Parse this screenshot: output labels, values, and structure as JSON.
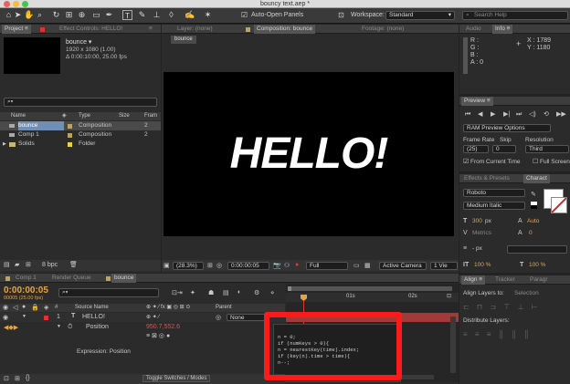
{
  "window": {
    "title": "bouncy text.aep *"
  },
  "toolbar": {
    "auto_open_label": "Auto-Open Panels",
    "workspace_label": "Workspace:",
    "workspace_value": "Standard",
    "search_placeholder": "Search Help"
  },
  "project": {
    "tabs": [
      "Project ≡",
      "Effect Controls: HELLO!"
    ],
    "preview_name": "bounce ▾",
    "preview_line1": "1920 x 1080 (1.00)",
    "preview_line2": "Δ 0:00:10:00, 25.00 fps",
    "search_value": "⌕▾",
    "columns": {
      "name": "Name",
      "type": "Type",
      "size": "Size",
      "frame": "Fram"
    },
    "items": [
      {
        "name": "bounce",
        "type": "Composition",
        "size": "2",
        "color": "#b8a36a"
      },
      {
        "name": "Comp 1",
        "type": "Composition",
        "size": "2",
        "color": "#b8a36a"
      },
      {
        "name": "Solids",
        "type": "Folder",
        "size": "",
        "color": "#e8d24a"
      }
    ],
    "bpc": "8 bpc"
  },
  "viewer": {
    "tabs": [
      "Layer: (none)",
      "Composition: bounce",
      "Footage: (none)"
    ],
    "breadcrumb": "bounce",
    "canvas_text": "HELLO!",
    "zoom": "(28.3%)",
    "timecode": "0:00:00:05",
    "resolution": "Full",
    "camera": "Active Camera",
    "views": "1 Vie"
  },
  "info": {
    "tabs": [
      "Audio",
      "Info ≡"
    ],
    "r": "R :",
    "g": "G :",
    "b": "B :",
    "a": "A : 0",
    "x": "X : 1789",
    "y": "Y : 1180"
  },
  "preview": {
    "tab": "Preview ≡",
    "ram_options": "RAM Preview Options",
    "frame_rate_label": "Frame Rate",
    "skip_label": "Skip",
    "resolution_label": "Resolution",
    "frame_rate": "(25)",
    "skip": "0",
    "resolution": "Third",
    "from_current": "From Current Time",
    "full_screen": "Full Screen"
  },
  "character": {
    "tabs": [
      "Effects & Presets",
      "Charact"
    ],
    "font": "Roboto",
    "style": "Medium Italic",
    "size": "300",
    "size_unit": "px",
    "leading": "Auto",
    "kerning": "Metrics",
    "tracking": "0",
    "indent": "- px",
    "vscale": "100 %",
    "hscale": "100 %"
  },
  "align": {
    "tabs": [
      "Align ≡",
      "Tracker",
      "Paragr"
    ],
    "layers_to": "Align Layers to:",
    "selection": "Selection",
    "distribute": "Distribute Layers:"
  },
  "timeline": {
    "tabs": [
      "Comp 1",
      "Render Queue",
      "bounce"
    ],
    "timecode": "0:00:00:05",
    "timecode_sub": "00005 (25.00 fps)",
    "search_value": "⌕▾",
    "col_source": "Source Name",
    "col_parent": "Parent",
    "layer_num": "1",
    "layer_name": "HELLO!",
    "layer_parent": "None",
    "property": "Position",
    "position_value": "950.7,552.6",
    "expression_label": "Expression: Position",
    "ruler": [
      "01s",
      "02s"
    ],
    "code": [
      "n = 0;",
      "if (numKeys > 0){",
      "n = nearestKey(time).index;",
      "if (key(n).time > time){",
      "n--;"
    ],
    "toggle": "Toggle Switches / Modes"
  }
}
